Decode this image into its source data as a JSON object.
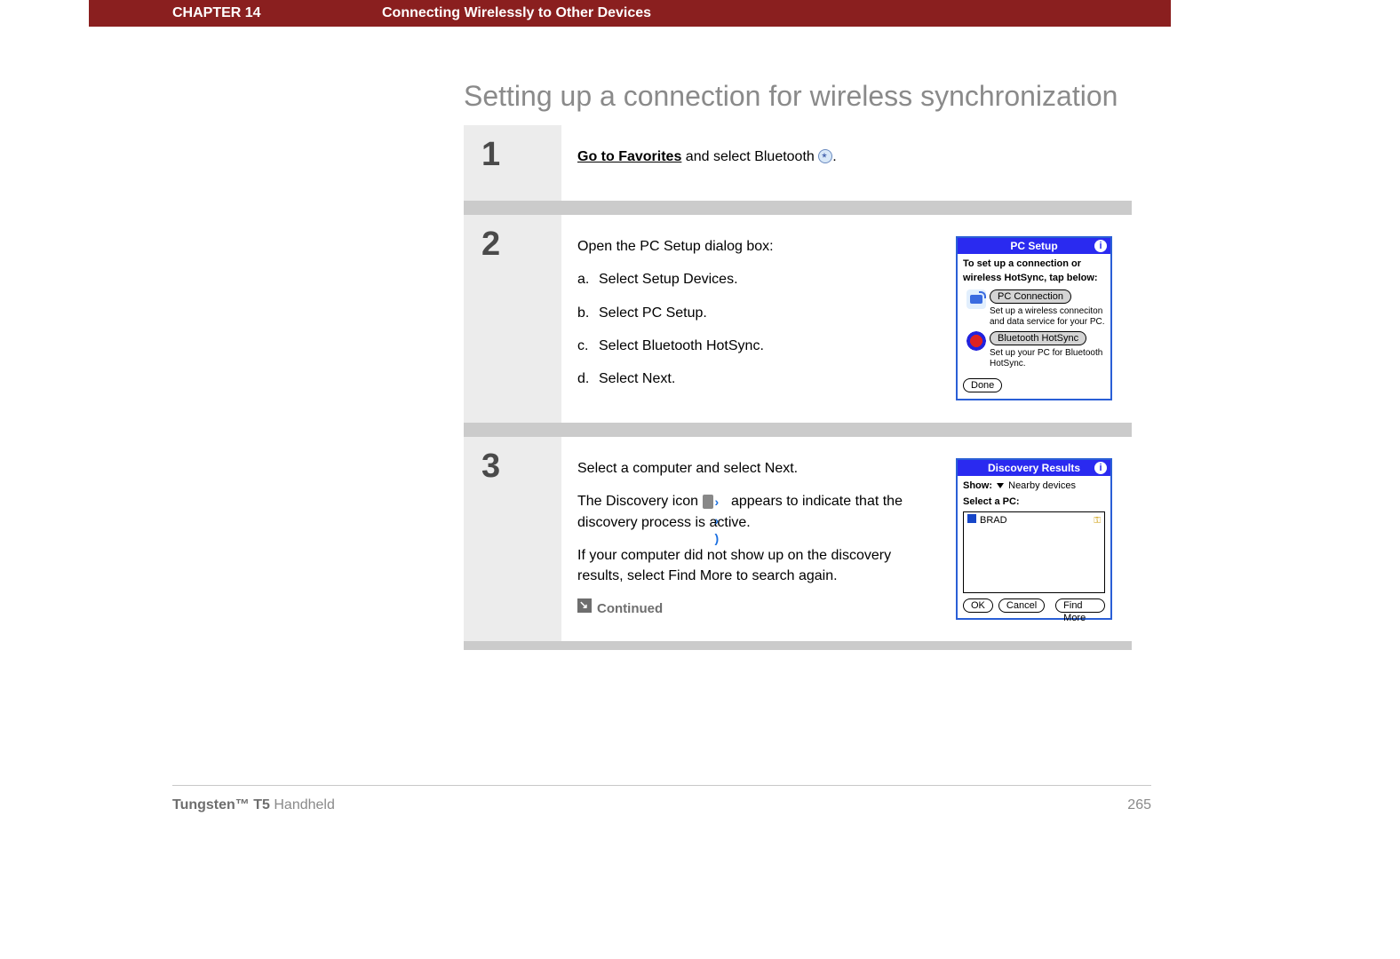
{
  "header": {
    "chapter": "CHAPTER 14",
    "title": "Connecting Wirelessly to Other Devices"
  },
  "section_title": "Setting up a connection for wireless synchronization",
  "steps": [
    {
      "num": "1",
      "intro_link": "Go to Favorites",
      "intro_rest": " and select Bluetooth ",
      "intro_tail": "."
    },
    {
      "num": "2",
      "lead": "Open the PC Setup dialog box:",
      "items": [
        {
          "letter": "a.",
          "text": "Select Setup Devices."
        },
        {
          "letter": "b.",
          "text": "Select PC Setup."
        },
        {
          "letter": "c.",
          "text": "Select Bluetooth HotSync."
        },
        {
          "letter": "d.",
          "text": "Select Next."
        }
      ],
      "palm": {
        "title": "PC Setup",
        "heading": "To set up a connection or wireless HotSync, tap below:",
        "opt1_btn": "PC Connection",
        "opt1_desc": "Set up a wireless conneciton and data service for your PC.",
        "opt2_btn": "Bluetooth HotSync",
        "opt2_desc": "Set up your PC for Bluetooth HotSync.",
        "done": "Done"
      }
    },
    {
      "num": "3",
      "para1": "Select a computer and select Next.",
      "para2a": "The Discovery icon ",
      "para2b": " appears to indicate that the discovery process is active.",
      "para3": "If your computer did not show up on the discovery results, select Find More to search again.",
      "continued": "Continued",
      "palm": {
        "title": "Discovery Results",
        "show_label": "Show:",
        "show_value": "Nearby devices",
        "select_label": "Select a PC:",
        "row1": "BRAD",
        "ok": "OK",
        "cancel": "Cancel",
        "find_more": "Find More"
      }
    }
  ],
  "footer": {
    "product_bold": "Tungsten™ T5",
    "product_rest": " Handheld",
    "page": "265"
  }
}
